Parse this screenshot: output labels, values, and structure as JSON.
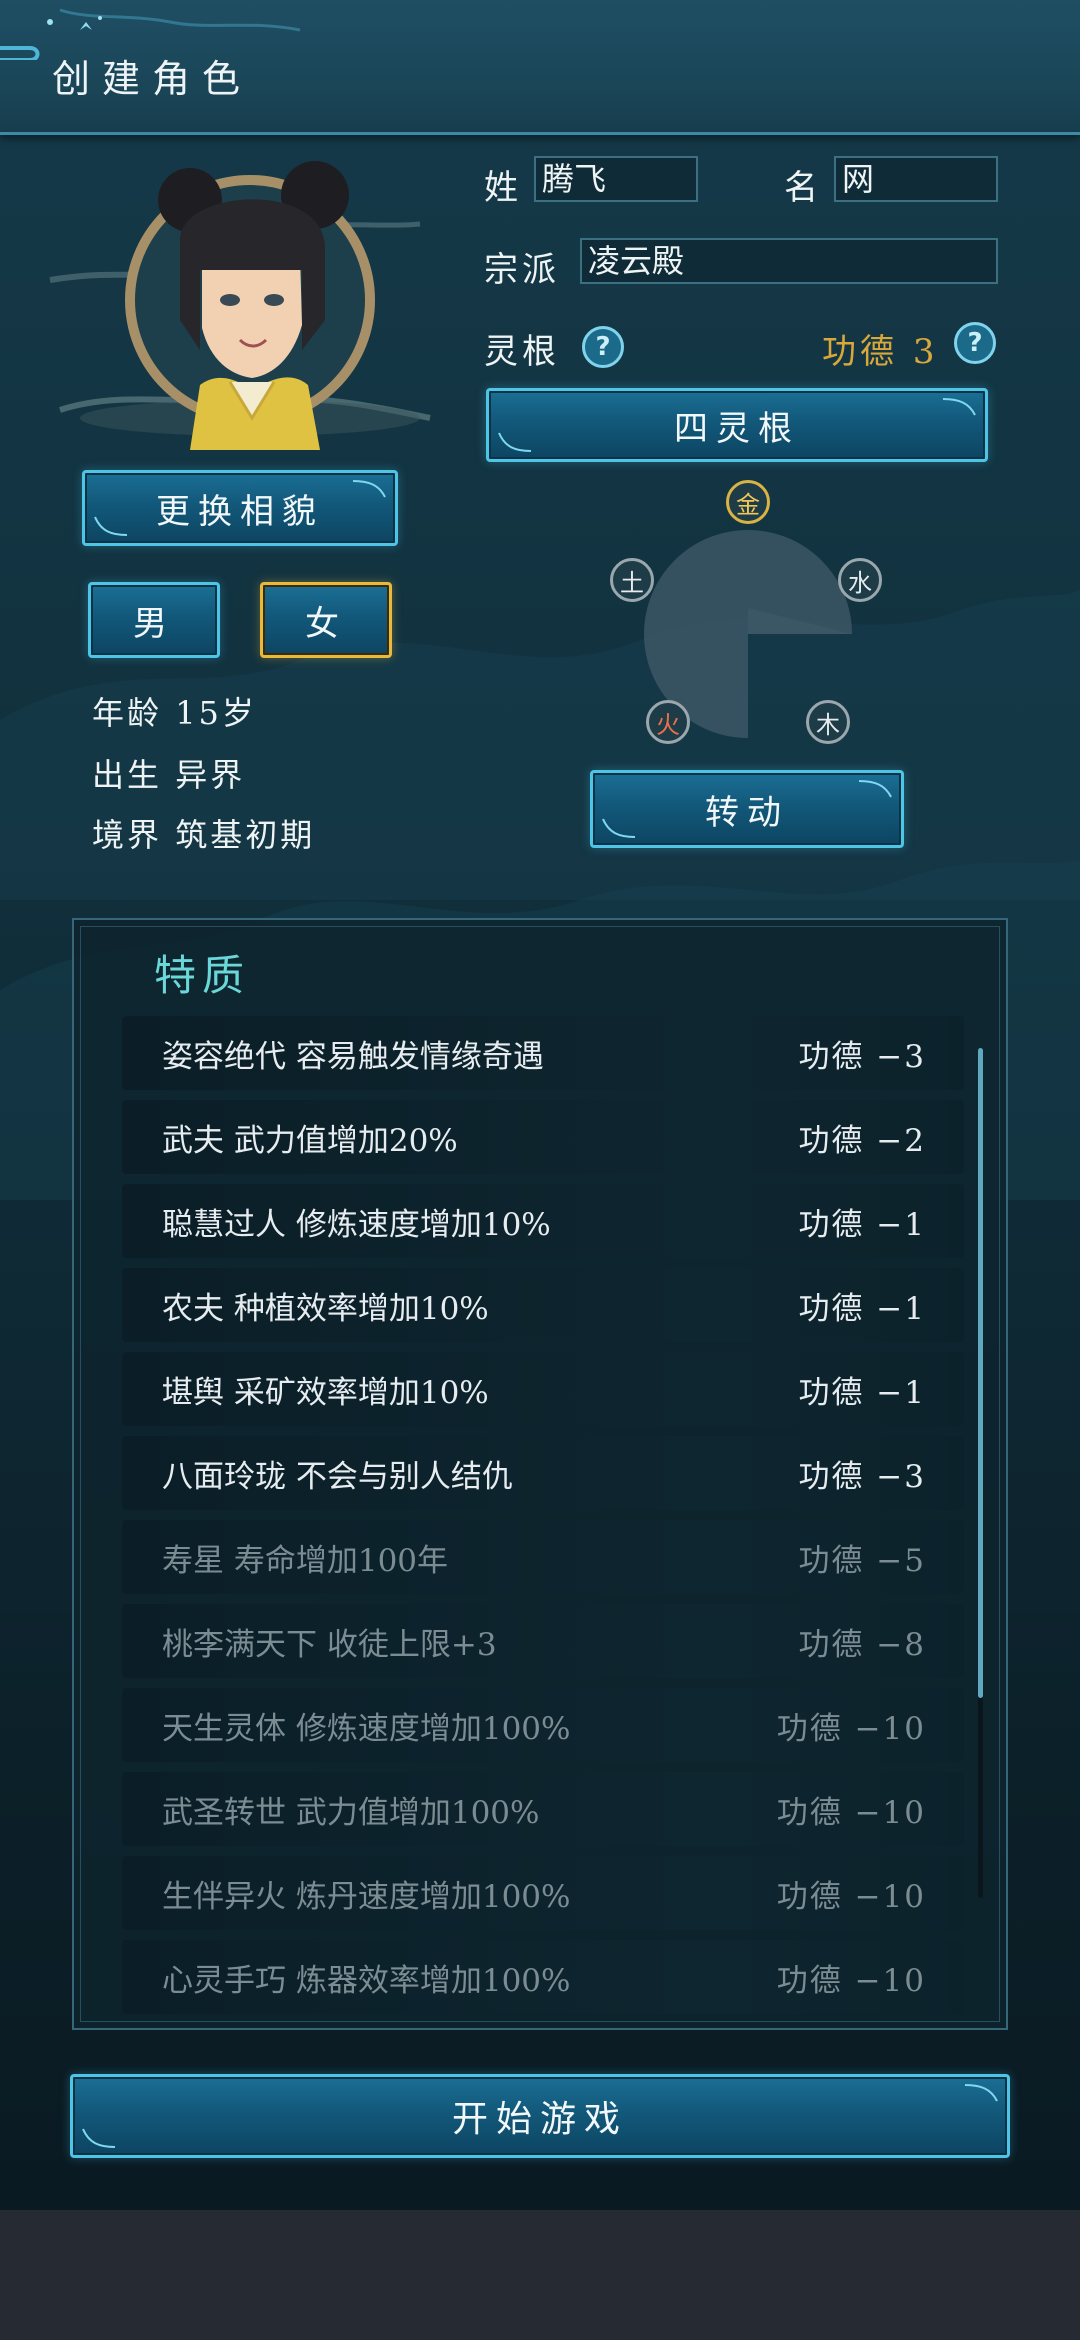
{
  "header": {
    "title": "创建角色"
  },
  "avatar": {
    "change_label": "更换相貌"
  },
  "gender": {
    "male": "男",
    "female": "女",
    "selected": "女"
  },
  "info": {
    "age_label": "年龄",
    "age_value": "15岁",
    "birth_label": "出生",
    "birth_value": "异界",
    "realm_label": "境界",
    "realm_value": "筑基初期"
  },
  "form": {
    "surname_label": "姓",
    "surname_value": "腾飞",
    "name_label": "名",
    "name_value": "网",
    "sect_label": "宗派",
    "sect_value": "凌云殿",
    "root_label": "灵根",
    "help_glyph": "?"
  },
  "merit": {
    "label": "功德",
    "value": "3"
  },
  "spirit_root": {
    "button_label": "四灵根",
    "spin_label": "转动",
    "elements": [
      "金",
      "水",
      "木",
      "火",
      "土"
    ]
  },
  "traits": {
    "title": "特质",
    "items": [
      {
        "desc": "姿容绝代 容易触发情缘奇遇",
        "cost": "功德 −3",
        "dim": false
      },
      {
        "desc": "武夫 武力值增加20%",
        "cost": "功德 −2",
        "dim": false
      },
      {
        "desc": "聪慧过人 修炼速度增加10%",
        "cost": "功德 −1",
        "dim": false
      },
      {
        "desc": "农夫 种植效率增加10%",
        "cost": "功德 −1",
        "dim": false
      },
      {
        "desc": "堪舆 采矿效率增加10%",
        "cost": "功德 −1",
        "dim": false
      },
      {
        "desc": "八面玲珑 不会与别人结仇",
        "cost": "功德 −3",
        "dim": false
      },
      {
        "desc": "寿星 寿命增加100年",
        "cost": "功德 −5",
        "dim": true
      },
      {
        "desc": "桃李满天下 收徒上限+3",
        "cost": "功德 −8",
        "dim": true
      },
      {
        "desc": "天生灵体 修炼速度增加100%",
        "cost": "功德 −10",
        "dim": true
      },
      {
        "desc": "武圣转世 武力值增加100%",
        "cost": "功德 −10",
        "dim": true
      },
      {
        "desc": "生伴异火 炼丹速度增加100%",
        "cost": "功德 −10",
        "dim": true
      },
      {
        "desc": "心灵手巧 炼器效率增加100%",
        "cost": "功德 −10",
        "dim": true
      }
    ]
  },
  "footer": {
    "start_label": "开始游戏"
  },
  "colors": {
    "accent": "#4ec4e6",
    "gold": "#d8a93a",
    "selected": "#e8b93a",
    "teal_title": "#6ad8d8"
  }
}
